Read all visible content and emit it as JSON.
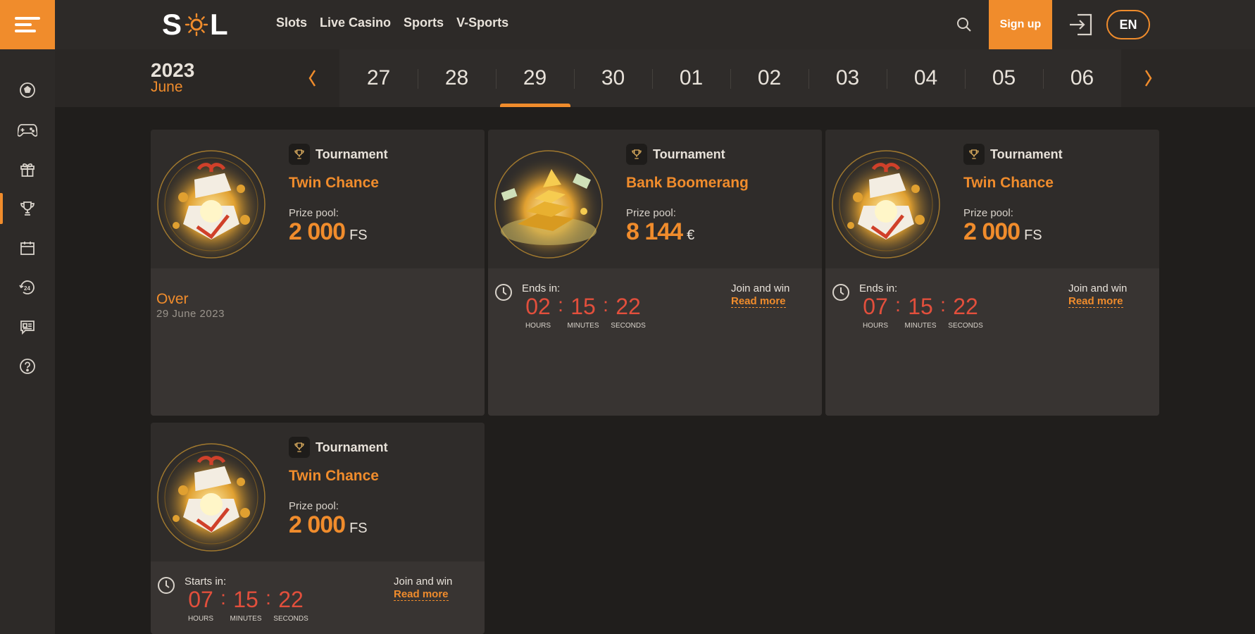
{
  "brand": {
    "logo_left": "S",
    "logo_right": "L",
    "accent": "#f08c2c",
    "timer_color": "#e24f3c"
  },
  "nav": {
    "items": [
      "Slots",
      "Live Casino",
      "Sports",
      "V-Sports"
    ]
  },
  "header": {
    "signup": "Sign up",
    "lang": "EN"
  },
  "sidebar": {
    "items": [
      {
        "icon": "soccer-ball-icon"
      },
      {
        "icon": "gamepad-icon"
      },
      {
        "icon": "gift-icon"
      },
      {
        "icon": "trophy-icon",
        "active": true
      },
      {
        "icon": "calendar-icon"
      },
      {
        "icon": "support-24-icon"
      },
      {
        "icon": "news-icon"
      },
      {
        "icon": "help-icon"
      }
    ]
  },
  "calendar": {
    "year": "2023",
    "month": "June",
    "days": [
      "27",
      "28",
      "29",
      "30",
      "01",
      "02",
      "03",
      "04",
      "05",
      "06"
    ],
    "selected": "29"
  },
  "cards": [
    {
      "badge": "Tournament",
      "title": "Twin Chance",
      "prize_label": "Prize pool:",
      "prize_value": "2 000",
      "prize_unit": "FS",
      "status": "over",
      "over_label": "Over",
      "over_date": "29 June 2023",
      "image": "gift-box"
    },
    {
      "badge": "Tournament",
      "title": "Bank Boomerang",
      "prize_label": "Prize pool:",
      "prize_value": "8 144",
      "prize_unit": "€",
      "status": "running",
      "timer_label": "Ends in:",
      "hours": "02",
      "minutes": "15",
      "seconds": "22",
      "hours_cap": "HOURS",
      "minutes_cap": "MINUTES",
      "seconds_cap": "SECONDS",
      "join_label": "Join and win",
      "read_more": "Read more",
      "image": "gold-bars"
    },
    {
      "badge": "Tournament",
      "title": "Twin Chance",
      "prize_label": "Prize pool:",
      "prize_value": "2 000",
      "prize_unit": "FS",
      "status": "running",
      "timer_label": "Ends in:",
      "hours": "07",
      "minutes": "15",
      "seconds": "22",
      "hours_cap": "HOURS",
      "minutes_cap": "MINUTES",
      "seconds_cap": "SECONDS",
      "join_label": "Join and win",
      "read_more": "Read more",
      "image": "gift-box"
    },
    {
      "badge": "Tournament",
      "title": "Twin Chance",
      "prize_label": "Prize pool:",
      "prize_value": "2 000",
      "prize_unit": "FS",
      "status": "upcoming",
      "timer_label": "Starts in:",
      "hours": "07",
      "minutes": "15",
      "seconds": "22",
      "hours_cap": "HOURS",
      "minutes_cap": "MINUTES",
      "seconds_cap": "SECONDS",
      "join_label": "Join and win",
      "read_more": "Read more",
      "image": "gift-box"
    }
  ]
}
